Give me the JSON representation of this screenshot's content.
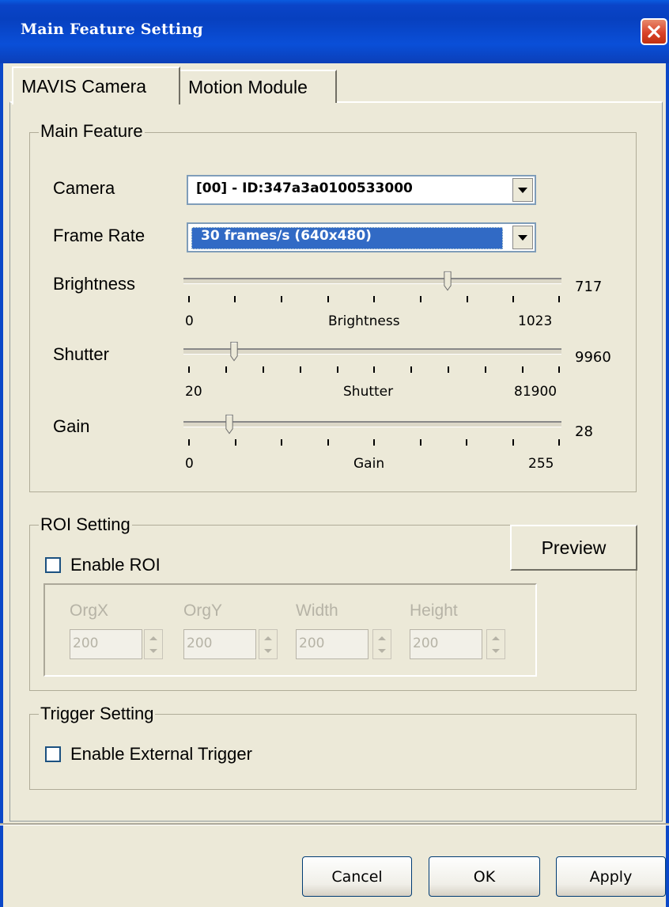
{
  "window": {
    "title": "Main Feature Setting"
  },
  "tabs": [
    {
      "label": "MAVIS Camera"
    },
    {
      "label": "Motion Module"
    }
  ],
  "main_feature": {
    "group_label": "Main Feature",
    "camera": {
      "label": "Camera",
      "value": "[00] - ID:347a3a0100533000"
    },
    "frame_rate": {
      "label": "Frame Rate",
      "value": "30 frames/s (640x480)"
    },
    "brightness": {
      "label": "Brightness",
      "value": "717",
      "min": "0",
      "max": "1023",
      "caption": "Brightness",
      "level": 0.7
    },
    "shutter": {
      "label": "Shutter",
      "value": "9960",
      "min": "20",
      "max": "81900",
      "caption": "Shutter",
      "level": 0.12
    },
    "gain": {
      "label": "Gain",
      "value": "28",
      "min": "0",
      "max": "255",
      "caption": "Gain",
      "level": 0.11
    }
  },
  "roi": {
    "group_label": "ROI Setting",
    "enable_label": "Enable ROI",
    "preview_label": "Preview",
    "fields": [
      {
        "label": "OrgX",
        "value": "200"
      },
      {
        "label": "OrgY",
        "value": "200"
      },
      {
        "label": "Width",
        "value": "200"
      },
      {
        "label": "Height",
        "value": "200"
      }
    ]
  },
  "trigger": {
    "group_label": "Trigger Setting",
    "enable_label": "Enable External Trigger"
  },
  "buttons": {
    "cancel": "Cancel",
    "ok": "OK",
    "apply": "Apply"
  }
}
